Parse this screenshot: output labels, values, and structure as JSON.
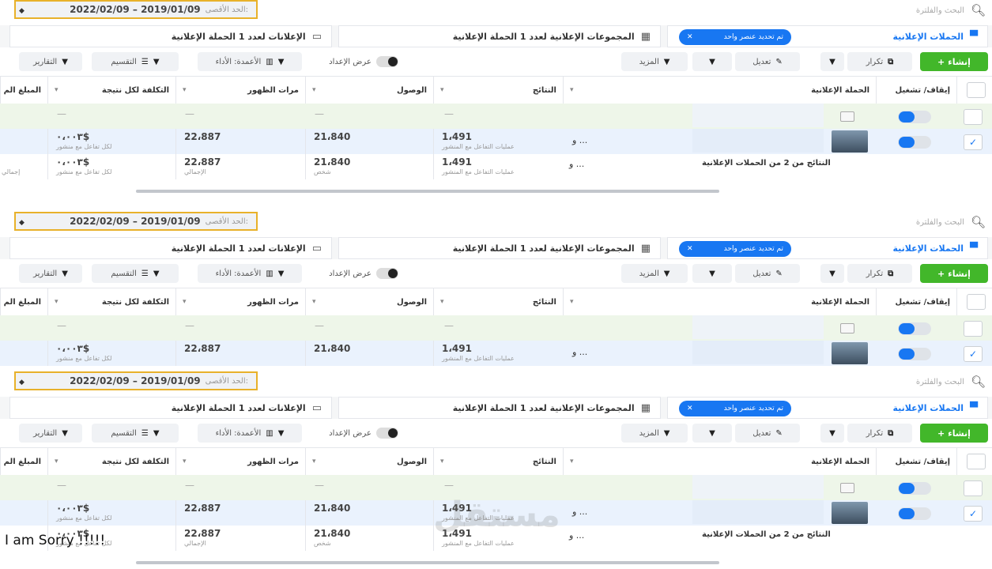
{
  "date_range": {
    "label": "الحد الأقصى:",
    "value": "2022/02/09 – 2019/01/09"
  },
  "search": {
    "placeholder": "البحث والفلترة",
    "icon": "search-icon"
  },
  "tabs": {
    "campaigns": "الحملات الإعلانية",
    "selected_badge": "تم تحديد عنصر واحد",
    "adsets": "المجموعات الإعلانية لعدد 1 الحملة الإعلانية",
    "ads": "الإعلانات لعدد 1 الحملة الإعلانية"
  },
  "toolbar": {
    "create": "+ إنشاء",
    "duplicate": "تكرار",
    "edit": "تعديل",
    "more": "المزيد",
    "view_setup": "عرض الإعداد",
    "columns": "الأعمدة: الأداء",
    "breakdown": "التقسيم",
    "reports": "التقارير"
  },
  "columns": {
    "onoff": "إيقاف/ تشغيل",
    "campaign": "الحملة الإعلانية",
    "results": "النتائج",
    "reach": "الوصول",
    "impressions": "مرات الظهور",
    "cost_per_result": "التكلفة لكل نتيجة",
    "amount_spent": "المبلغ الم"
  },
  "row_campaign": {
    "results": "1،491",
    "results_sub": "عمليات التفاعل مع المنشور",
    "reach": "21،840",
    "impressions": "22،887",
    "cost": "٠،٠٠٣$",
    "cost_sub": "لكل تفاعل مع منشور",
    "more": "و ..."
  },
  "totals_row": {
    "label": "النتائج من 2 من الحملات الإعلانية",
    "more": "و ...",
    "results": "1،491",
    "results_sub": "عمليات التفاعل مع المنشور",
    "reach": "21،840",
    "reach_sub": "شخص",
    "impressions": "22،887",
    "impressions_sub": "الإجمالي",
    "cost": "٠،٠٠٣$",
    "cost_sub": "لكل تفاعل مع منشور",
    "spent_sub": "إجمالي"
  },
  "dash": "—",
  "caption": "I am Sorry !!!!!",
  "watermark": "مستقل",
  "colors": {
    "accent": "#1877f2",
    "create": "#42b72a",
    "highlight_border": "#e8b12a",
    "green_row": "#eef6e9",
    "blue_row": "#eaf2fd"
  }
}
